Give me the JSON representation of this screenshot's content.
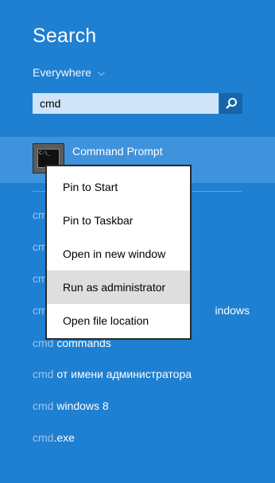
{
  "header": {
    "title": "Search"
  },
  "scope": {
    "label": "Everywhere",
    "chevron": "⌵"
  },
  "search": {
    "value": "cmd",
    "icon": "search-icon"
  },
  "top_result": {
    "title": "Command Prompt",
    "icon": "command-prompt-icon",
    "icon_text": "C:\\_"
  },
  "context_menu": {
    "items": [
      {
        "label": "Pin to Start"
      },
      {
        "label": "Pin to Taskbar"
      },
      {
        "label": "Open in new window"
      },
      {
        "label": "Run as administrator"
      },
      {
        "label": "Open file location"
      }
    ]
  },
  "suggestions": [
    {
      "query": "cmd",
      "rest": ""
    },
    {
      "query": "cmd",
      "rest": ""
    },
    {
      "query": "cmd",
      "rest": ""
    },
    {
      "query": "cmd",
      "rest": "indows"
    },
    {
      "query": "cmd",
      "rest": " commands"
    },
    {
      "query": "cmd",
      "rest": " от имени администратора"
    },
    {
      "query": "cmd",
      "rest": " windows 8"
    },
    {
      "query": "cmd",
      "rest": ".exe"
    }
  ],
  "colors": {
    "background": "#1f7fd0",
    "search_button": "#1565a8",
    "search_field": "#cfe4f8",
    "selected_row": "#3e93dc",
    "menu_hover": "#dedede"
  }
}
